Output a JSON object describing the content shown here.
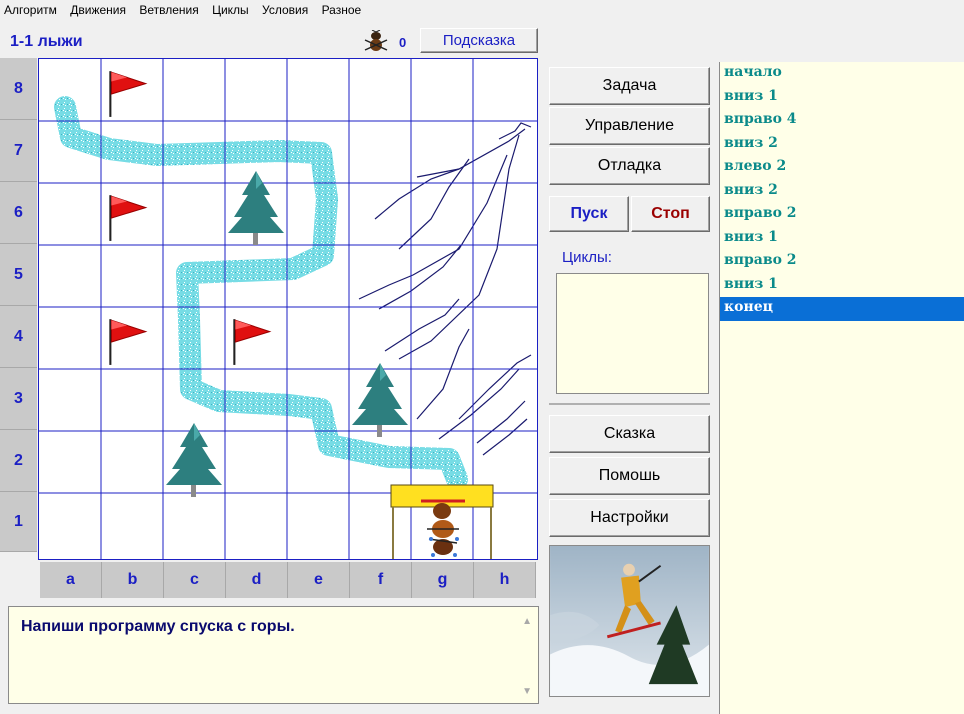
{
  "menu": [
    "Алгоритм",
    "Движения",
    "Ветвления",
    "Циклы",
    "Условия",
    "Разное"
  ],
  "level": {
    "title": "1-1 лыжи",
    "score": "0",
    "hint_label": "Подсказка"
  },
  "board": {
    "rows": [
      "8",
      "7",
      "6",
      "5",
      "4",
      "3",
      "2",
      "1"
    ],
    "cols": [
      "a",
      "b",
      "c",
      "d",
      "e",
      "f",
      "g",
      "h"
    ]
  },
  "task": {
    "text": "Напиши программу спуска с горы."
  },
  "side": {
    "task_btn": "Задача",
    "control_btn": "Управление",
    "debug_btn": "Отладка",
    "run_btn": "Пуск",
    "stop_btn": "Стоп",
    "cycles_label": "Циклы:",
    "story_btn": "Сказка",
    "help_btn": "Помошь",
    "settings_btn": "Настройки"
  },
  "program": {
    "lines": [
      "начало",
      "вниз 1",
      "вправо 4",
      "вниз 2",
      "влево 2",
      "вниз 2",
      "вправо 2",
      "вниз 1",
      "вправо 2",
      "вниз 1",
      "конец"
    ],
    "selected_index": 10
  },
  "colors": {
    "accent": "#1b1fc4",
    "program_text": "#0a8a8a",
    "selection": "#0a6fd6",
    "panel_bg": "#ffffe8"
  }
}
